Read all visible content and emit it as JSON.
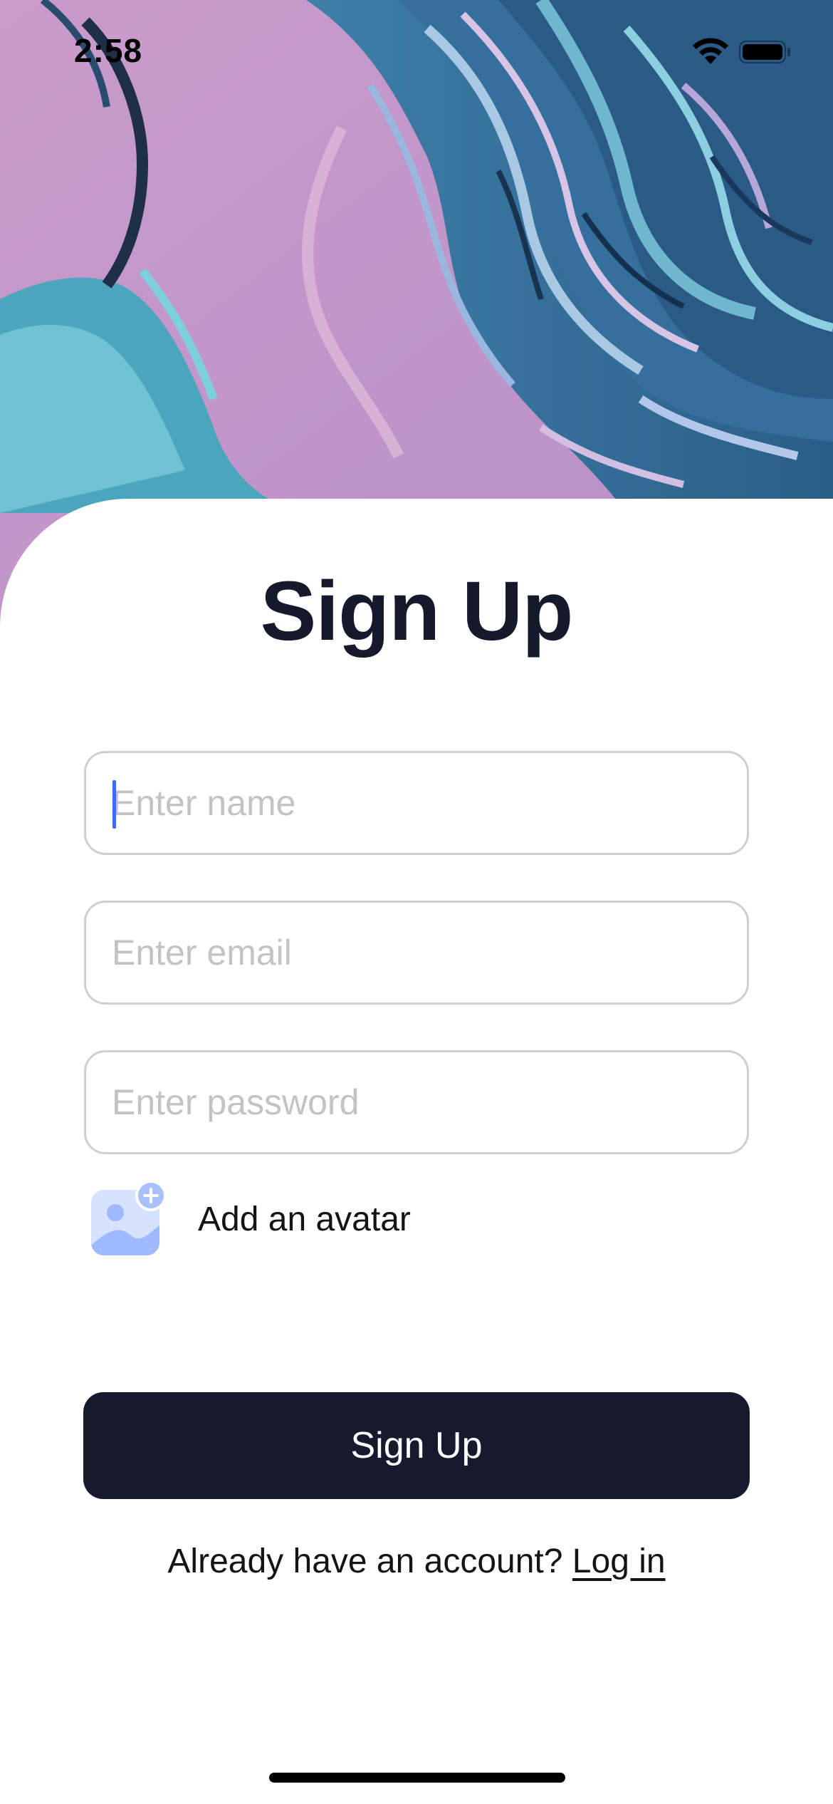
{
  "status_bar": {
    "time": "2:58",
    "wifi_icon": "wifi-icon",
    "battery_icon": "battery-icon"
  },
  "hero": {
    "description_icon": "marble-background",
    "colors": [
      "#c79ac9",
      "#4f9fb9",
      "#2a5d86",
      "#8fa0cf",
      "#1b3a5c"
    ]
  },
  "title": "Sign Up",
  "form": {
    "name": {
      "placeholder": "Enter name",
      "value": ""
    },
    "email": {
      "placeholder": "Enter email",
      "value": ""
    },
    "password": {
      "placeholder": "Enter password",
      "value": ""
    }
  },
  "avatar": {
    "icon": "add-image-icon",
    "label": "Add an avatar"
  },
  "submit_label": "Sign Up",
  "login": {
    "prompt": "Already have an account?",
    "link_label": "Log in"
  },
  "colors": {
    "primary": "#151b2c",
    "caret": "#3a6cf6",
    "field_border": "#cfcfd2",
    "placeholder": "#c3c3c7"
  }
}
